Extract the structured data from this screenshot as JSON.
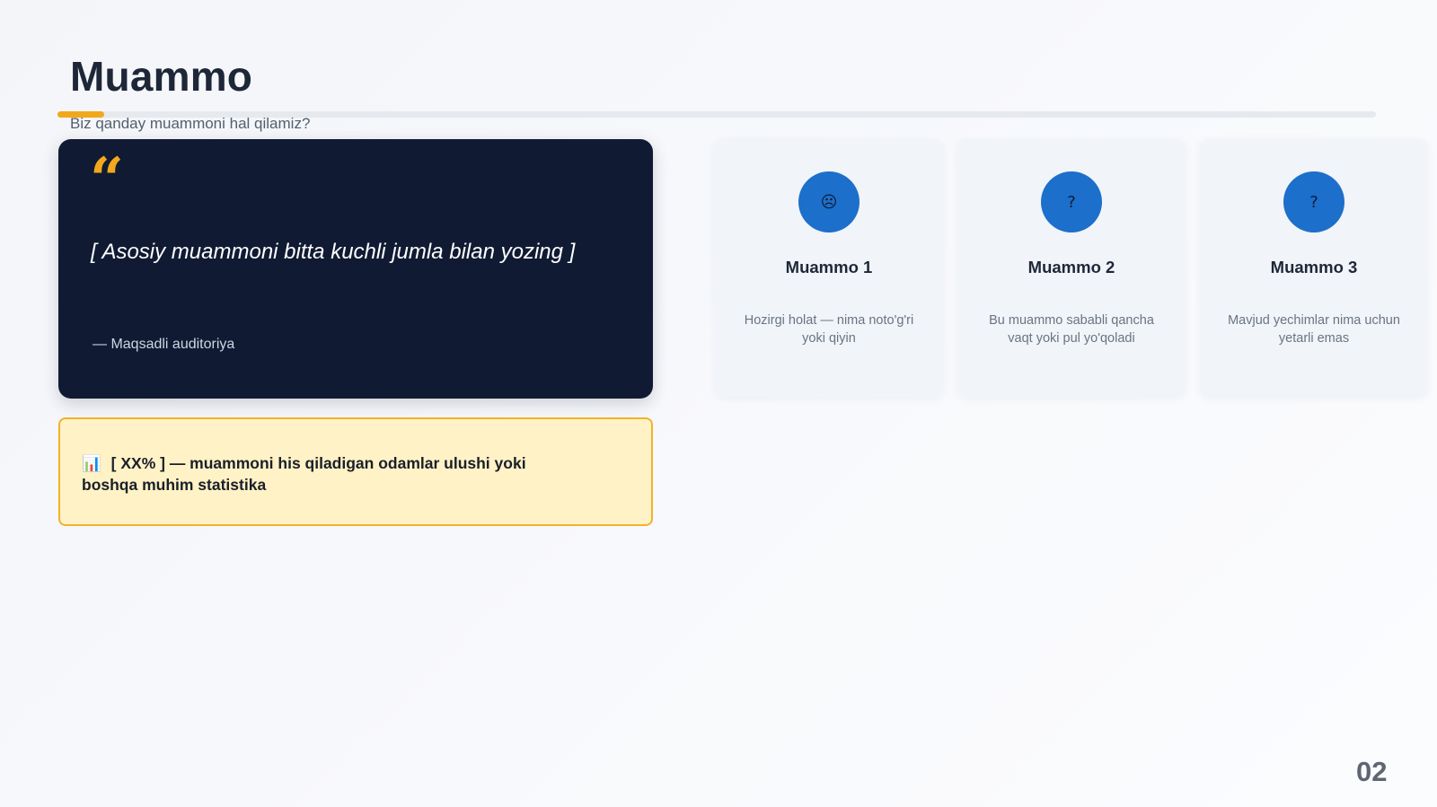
{
  "slide": {
    "title": "Muammo",
    "subtitle": "Biz qanday muammoni hal qilamiz?",
    "page_number": "02"
  },
  "quote": {
    "mark": "“",
    "text": "[ Asosiy muammoni bitta kuchli jumla bilan yozing ]",
    "author": "— Maqsadli auditoriya"
  },
  "stat": {
    "icon": "bar-chart-icon",
    "icon_glyph": "📊",
    "text": "[ XX% ] — muammoni his qiladigan odamlar ulushi yoki boshqa muhim statistika"
  },
  "cards": [
    {
      "icon": "frown-face-icon",
      "icon_glyph": "☹",
      "title": "Muammo 1",
      "description": "Hozirgi holat — nima noto'g'ri yoki qiyin"
    },
    {
      "icon": "question-icon",
      "icon_glyph": "?",
      "title": "Muammo 2",
      "description": "Bu muammo sababli qancha vaqt yoki pul yo'qoladi"
    },
    {
      "icon": "question-icon",
      "icon_glyph": "?",
      "title": "Muammo 3",
      "description": "Mavjud yechimlar nima uchun yetarli emas"
    }
  ],
  "colors": {
    "accent": "#f2a81d",
    "quote_panel_bg": "#101b33",
    "stat_box_bg": "#fff2c6",
    "card_icon_bg": "#1c6fcb",
    "card_bg": "#f1f4f8"
  }
}
